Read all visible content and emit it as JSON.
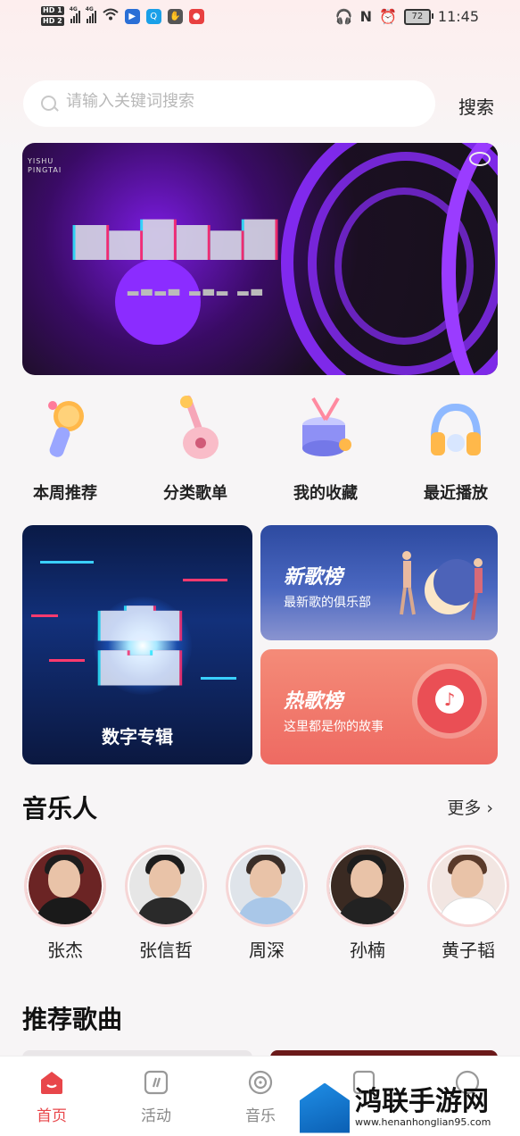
{
  "status_bar": {
    "hd_top": "HD 1",
    "hd_bottom": "HD 2",
    "net1": "4G",
    "net2": "4G",
    "battery": "72",
    "time": "11:45"
  },
  "search": {
    "placeholder": "请输入关键词搜索",
    "button": "搜索"
  },
  "banner": {
    "tag_line1": "YISHU",
    "tag_line2": "PINGTAI"
  },
  "quick_entries": [
    {
      "label": "本周推荐",
      "icon": "microphone-icon"
    },
    {
      "label": "分类歌单",
      "icon": "guitar-icon"
    },
    {
      "label": "我的收藏",
      "icon": "drum-icon"
    },
    {
      "label": "最近播放",
      "icon": "headphones-icon"
    }
  ],
  "cards": {
    "digital_album": {
      "caption": "数字专辑"
    },
    "new_songs": {
      "title": "新歌榜",
      "desc": "最新歌的俱乐部"
    },
    "hot_songs": {
      "title": "热歌榜",
      "desc": "这里都是你的故事"
    }
  },
  "artists_section": {
    "title": "音乐人",
    "more": "更多 ›",
    "artists": [
      {
        "name": "张杰"
      },
      {
        "name": "张信哲"
      },
      {
        "name": "周深"
      },
      {
        "name": "孙楠"
      },
      {
        "name": "黄子韬"
      }
    ]
  },
  "songs_section": {
    "title": "推荐歌曲"
  },
  "tab_bar": {
    "tabs": [
      {
        "label": "首页",
        "icon": "home-icon",
        "active": true
      },
      {
        "label": "活动",
        "icon": "activity-icon",
        "active": false
      },
      {
        "label": "音乐",
        "icon": "disc-icon",
        "active": false
      }
    ]
  },
  "watermark": {
    "name": "鸿联手游网",
    "url": "www.henanhonglian95.com"
  },
  "colors": {
    "accent": "#e8464a",
    "banner_purple": "#8a2cff",
    "new_chart_blue": "#4a67c0",
    "hot_chart_red": "#ee6a62"
  }
}
